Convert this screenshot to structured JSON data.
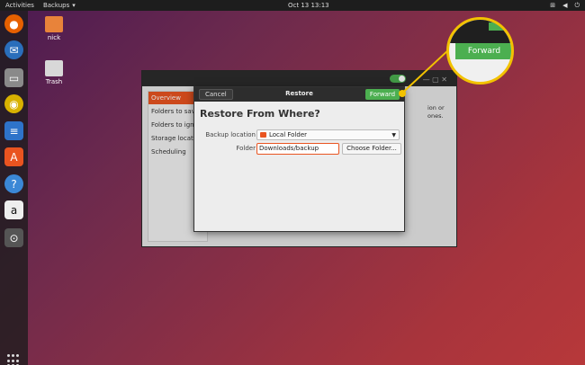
{
  "topbar": {
    "activities": "Activities",
    "app_name": "Backups",
    "clock": "Oct 13  13:13",
    "tray_icons": [
      "network-icon",
      "volume-icon",
      "power-icon"
    ]
  },
  "dock": {
    "apps": [
      "firefox-icon",
      "thunderbird-icon",
      "files-icon",
      "rhythmbox-icon",
      "writer-icon",
      "software-icon",
      "help-icon",
      "amazon-icon",
      "backups-icon"
    ]
  },
  "desktop": {
    "icons": [
      {
        "label": "nick",
        "icon": "home-folder-icon"
      },
      {
        "label": "Trash",
        "icon": "trash-icon"
      }
    ]
  },
  "backup_window": {
    "sidebar": [
      "Overview",
      "Folders to save",
      "Folders to ignore",
      "Storage location",
      "Scheduling"
    ],
    "active_item": "Overview",
    "body_text": [
      "ion or",
      "ones."
    ]
  },
  "dialog": {
    "cancel": "Cancel",
    "title": "Restore",
    "forward": "Forward",
    "heading": "Restore From Where?",
    "backup_location_label": "Backup location",
    "backup_location_value": "Local Folder",
    "folder_label": "Folder",
    "folder_value": "Downloads/backup",
    "choose_folder": "Choose Folder..."
  },
  "callout": {
    "label": "Forward",
    "color": "#f2c200"
  },
  "colors": {
    "accent": "#e95420",
    "forward_green": "#4caf50"
  }
}
